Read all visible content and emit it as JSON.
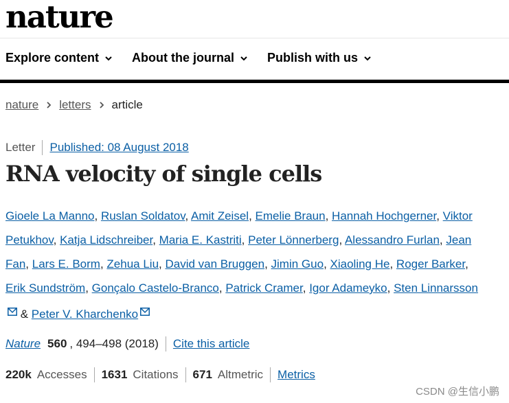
{
  "logo": "nature",
  "nav": {
    "items": [
      {
        "label": "Explore content"
      },
      {
        "label": "About the journal"
      },
      {
        "label": "Publish with us"
      }
    ]
  },
  "breadcrumb": {
    "items": [
      "nature",
      "letters"
    ],
    "current": "article"
  },
  "article": {
    "type": "Letter",
    "published": "Published: 08 August 2018",
    "title": "RNA velocity of single cells",
    "authors": [
      "Gioele La Manno",
      "Ruslan Soldatov",
      "Amit Zeisel",
      "Emelie Braun",
      "Hannah Hochgerner",
      "Viktor Petukhov",
      "Katja Lidschreiber",
      "Maria E. Kastriti",
      "Peter Lönnerberg",
      "Alessandro Furlan",
      "Jean Fan",
      "Lars E. Borm",
      "Zehua Liu",
      "David van Bruggen",
      "Jimin Guo",
      "Xiaoling He",
      "Roger Barker",
      "Erik Sundström",
      "Gonçalo Castelo-Branco",
      "Patrick Cramer",
      "Igor Adameyko",
      "Sten Linnarsson",
      "Peter V. Kharchenko"
    ],
    "author_and": "&",
    "journal": "Nature",
    "volume": "560",
    "pages": ", 494–498 (2018)",
    "cite_label": "Cite this article"
  },
  "metrics": {
    "accesses_value": "220k",
    "accesses_label": "Accesses",
    "citations_value": "1631",
    "citations_label": "Citations",
    "altmetric_value": "671",
    "altmetric_label": "Altmetric",
    "metrics_link": "Metrics"
  },
  "watermark": "CSDN @生信小鹏"
}
